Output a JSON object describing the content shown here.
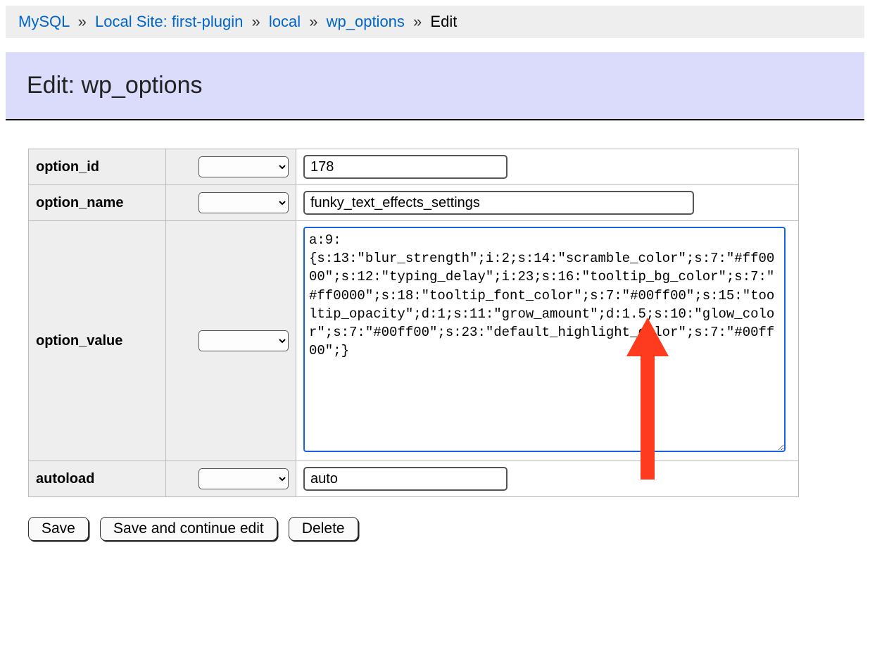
{
  "breadcrumb": {
    "links": [
      {
        "label": "MySQL"
      },
      {
        "label": "Local Site: first-plugin"
      },
      {
        "label": "local"
      },
      {
        "label": "wp_options"
      }
    ],
    "current": "Edit",
    "separator": "»"
  },
  "header": {
    "title": "Edit: wp_options"
  },
  "form": {
    "rows": {
      "option_id": {
        "label": "option_id",
        "func": "",
        "value": "178"
      },
      "option_name": {
        "label": "option_name",
        "func": "",
        "value": "funky_text_effects_settings"
      },
      "option_value": {
        "label": "option_value",
        "func": "",
        "value": "a:9:{s:13:\"blur_strength\";i:2;s:14:\"scramble_color\";s:7:\"#ff0000\";s:12:\"typing_delay\";i:23;s:16:\"tooltip_bg_color\";s:7:\"#ff0000\";s:18:\"tooltip_font_color\";s:7:\"#00ff00\";s:15:\"tooltip_opacity\";d:1;s:11:\"grow_amount\";d:1.5;s:10:\"glow_color\";s:7:\"#00ff00\";s:23:\"default_highlight_color\";s:7:\"#00ff00\";}"
      },
      "autoload": {
        "label": "autoload",
        "func": "",
        "value": "auto"
      }
    }
  },
  "actions": {
    "save": "Save",
    "save_continue": "Save and continue edit",
    "delete": "Delete"
  },
  "annotation": {
    "arrow_color": "#ff3b1f"
  }
}
